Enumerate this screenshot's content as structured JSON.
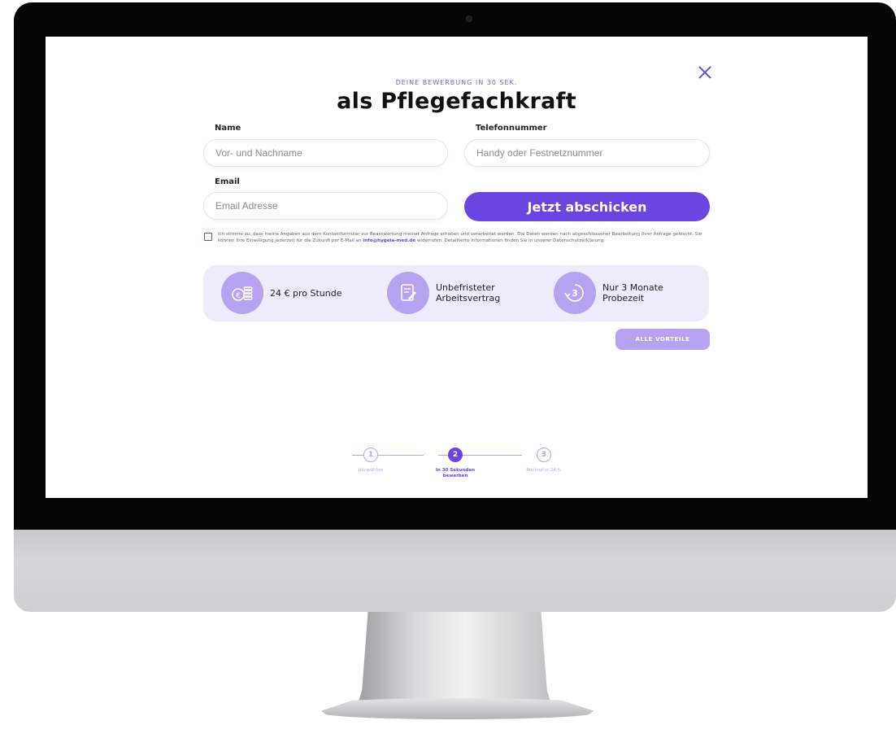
{
  "form": {
    "kicker": "DEINE BEWERBUNG IN 30 SEK.",
    "title": "als Pflegefachkraft",
    "name_label": "Name",
    "name_placeholder": "Vor- und Nachname",
    "phone_label": "Telefonnummer",
    "phone_placeholder": "Handy oder Festnetznummer",
    "email_label": "Email",
    "email_placeholder": "Email Adresse",
    "submit_label": "Jetzt abschicken",
    "consent_text_1": "Ich stimme zu, dass meine Angaben aus dem Kontaktformular zur Beantwortung meiner Anfrage erhoben und verarbeitet werden. Die Daten werden nach abgeschlossener Bearbeitung Ihrer Anfrage gelöscht. Sie können Ihre Einwilligung jederzeit für die Zukunft per E-Mail an",
    "consent_email": "info@hygeia-med.de",
    "consent_text_2": "widerrufen. Detaillierte Informationen finden Sie in unserer Datenschutzerklärung."
  },
  "benefits": [
    {
      "icon": "coins-euro-icon",
      "text": "24 € pro Stunde"
    },
    {
      "icon": "contract-icon",
      "text": "Unbefristeter Arbeitsvertrag"
    },
    {
      "icon": "three-months-icon",
      "text": "Nur 3 Monate Probezeit"
    }
  ],
  "all_benefits_label": "ALLE VORTEILE",
  "steps": [
    {
      "number": "1",
      "label": "Job wählen",
      "active": false
    },
    {
      "number": "2",
      "label": "In 30 Sekunden bewerben",
      "active": true
    },
    {
      "number": "3",
      "label": "Rückruf in 24 h.",
      "active": false
    }
  ],
  "colors": {
    "accent": "#6a45df",
    "accent_light": "#b6a2f1",
    "panel": "#eeebfb"
  }
}
